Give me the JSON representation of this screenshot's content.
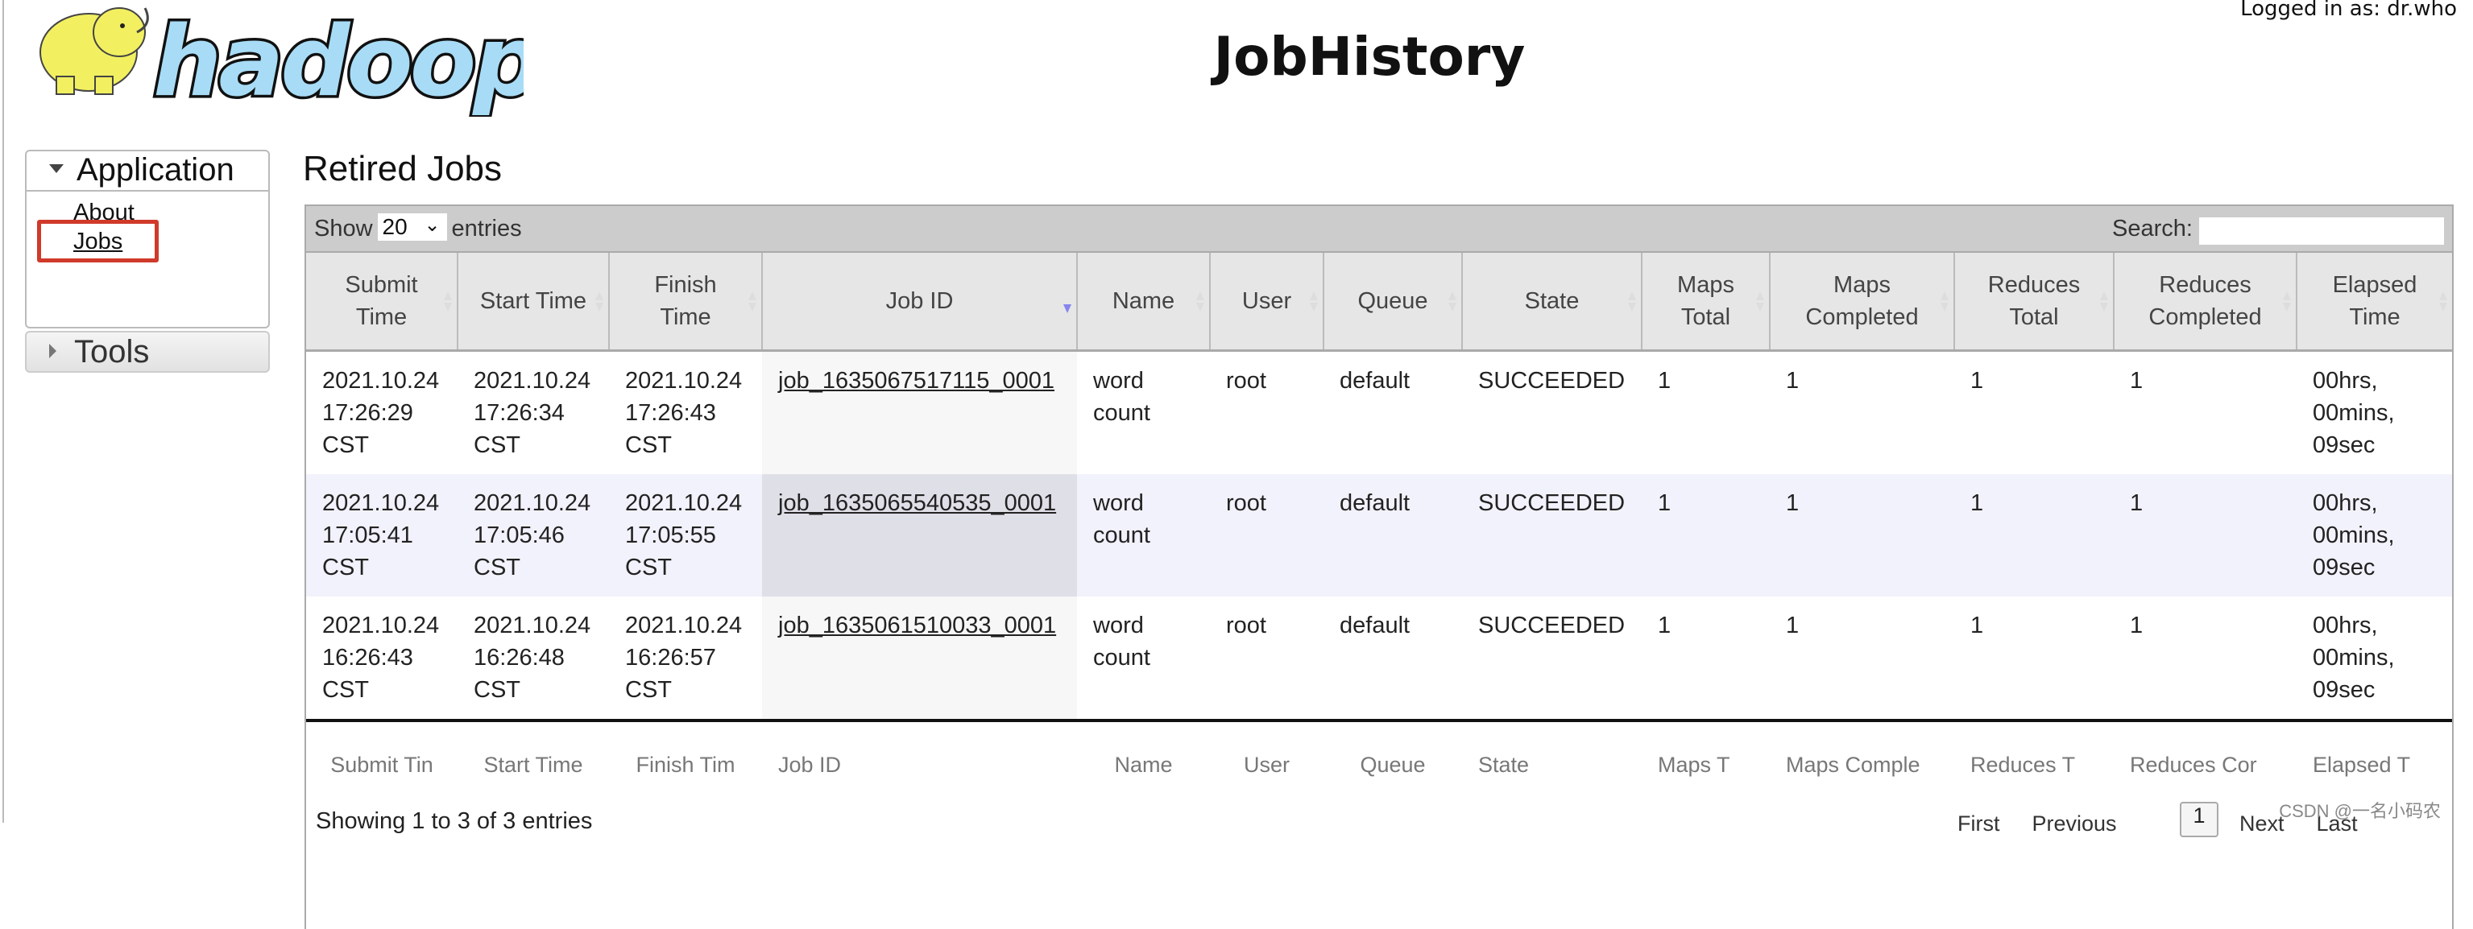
{
  "header": {
    "logo_text": "hadoop",
    "title": "JobHistory",
    "logged_in": "Logged in as: dr.who"
  },
  "sidebar": {
    "application_label": "Application",
    "items": [
      {
        "label": "About"
      },
      {
        "label": "Jobs"
      }
    ],
    "tools_label": "Tools"
  },
  "main": {
    "heading": "Retired Jobs",
    "show_label": "Show",
    "page_size": "20",
    "entries_label": "entries",
    "search_label": "Search:",
    "search_value": "",
    "columns": [
      "Submit Time",
      "Start Time",
      "Finish Time",
      "Job ID",
      "Name",
      "User",
      "Queue",
      "State",
      "Maps Total",
      "Maps Completed",
      "Reduces Total",
      "Reduces Completed",
      "Elapsed Time"
    ],
    "footer_columns": [
      "Submit Tin",
      "Start Time",
      "Finish Tim",
      "Job ID",
      "Name",
      "User",
      "Queue",
      "State",
      "Maps T",
      "Maps Comple",
      "Reduces T",
      "Reduces Cor",
      "Elapsed T"
    ],
    "sorted_column": "Job ID",
    "sort_color": "#8585f0",
    "rows": [
      [
        "2021.10.24 17:26:29 CST",
        "2021.10.24 17:26:34 CST",
        "2021.10.24 17:26:43 CST",
        "job_1635067517115_0001",
        "word count",
        "root",
        "default",
        "SUCCEEDED",
        "1",
        "1",
        "1",
        "1",
        "00hrs, 00mins, 09sec"
      ],
      [
        "2021.10.24 17:05:41 CST",
        "2021.10.24 17:05:46 CST",
        "2021.10.24 17:05:55 CST",
        "job_1635065540535_0001",
        "word count",
        "root",
        "default",
        "SUCCEEDED",
        "1",
        "1",
        "1",
        "1",
        "00hrs, 00mins, 09sec"
      ],
      [
        "2021.10.24 16:26:43 CST",
        "2021.10.24 16:26:48 CST",
        "2021.10.24 16:26:57 CST",
        "job_1635061510033_0001",
        "word count",
        "root",
        "default",
        "SUCCEEDED",
        "1",
        "1",
        "1",
        "1",
        "00hrs, 00mins, 09sec"
      ]
    ],
    "info": "Showing 1 to 3 of 3 entries",
    "pager": {
      "first": "First",
      "previous": "Previous",
      "page": "1",
      "next": "Next",
      "last": "Last"
    }
  },
  "watermark": "CSDN @一名小码农",
  "colors": {
    "highlight_box": "#d03a2a",
    "logo_blue": "#a8dcf6",
    "elephant_yellow": "#f2f060"
  }
}
